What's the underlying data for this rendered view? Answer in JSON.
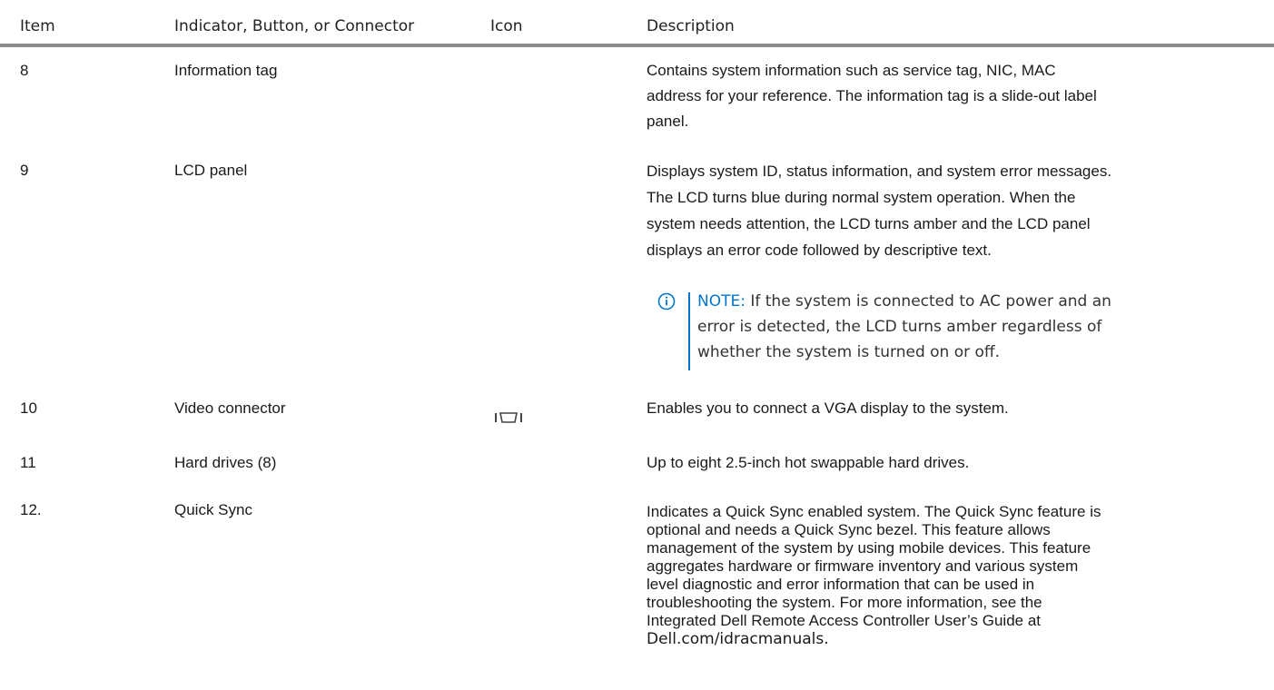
{
  "table": {
    "headers": {
      "item": "Item",
      "indicator": "Indicator, Button, or Connector",
      "icon": "Icon",
      "description": "Description"
    },
    "rows": [
      {
        "item": "8",
        "name": "Information tag",
        "description_lines": [
          "Contains system information such as service tag, NIC, MAC",
          "address for your reference. The information tag is a slide-out label",
          "panel."
        ]
      },
      {
        "item": "9",
        "name": "LCD panel",
        "description_lines": [
          "Displays system ID, status information, and system error messages.",
          "The LCD turns blue during normal system operation. When the",
          "system needs attention, the LCD turns amber and the LCD panel",
          "displays an error code followed by descriptive text."
        ],
        "note": {
          "label": "NOTE:",
          "lines": [
            " If the system is connected to AC power and an",
            "error is detected, the LCD turns amber regardless of",
            "whether the system is turned on or off."
          ]
        }
      },
      {
        "item": "10",
        "name": "Video connector",
        "icon": "vga-port-icon",
        "description_lines": [
          "Enables you to connect a VGA display to the system."
        ]
      },
      {
        "item": "11",
        "name": "Hard drives (8)",
        "description_lines": [
          "Up to eight 2.5-inch hot swappable hard drives."
        ]
      },
      {
        "item": "12.",
        "name": "Quick Sync",
        "description_lines": [
          "Indicates a Quick Sync enabled system. The Quick Sync feature is",
          "optional and needs a Quick Sync bezel. This feature allows",
          "management of the system by using mobile devices. This feature",
          "aggregates hardware or firmware inventory and various system",
          "level diagnostic and error information that can be used in",
          "troubleshooting the system. For more information, see the",
          "Integrated Dell Remote Access Controller User’s Guide at",
          "Dell.com/idracmanuals."
        ]
      }
    ]
  },
  "colors": {
    "note_accent": "#0076ce",
    "header_rule": "#8c8c8c",
    "text": "#1a1a1a"
  }
}
